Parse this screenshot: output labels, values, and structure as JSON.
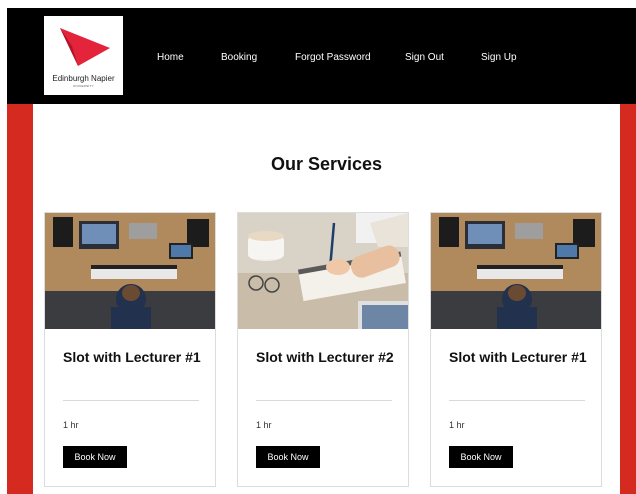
{
  "nav": {
    "logo_text": "Edinburgh Napier",
    "logo_sub": "UNIVERSITY",
    "items": [
      {
        "label": "Home"
      },
      {
        "label": "Booking"
      },
      {
        "label": "Forgot Password"
      },
      {
        "label": "Sign Out"
      },
      {
        "label": "Sign Up"
      }
    ]
  },
  "main": {
    "heading": "Our Services",
    "cards": [
      {
        "title": "Slot with Lecturer #1",
        "duration": "1 hr",
        "button_label": "Book Now",
        "image": "music-studio-desk-photo"
      },
      {
        "title": "Slot with Lecturer #2",
        "duration": "1 hr",
        "button_label": "Book Now",
        "image": "writing-notebook-coffee-photo"
      },
      {
        "title": "Slot with Lecturer #1",
        "duration": "1 hr",
        "button_label": "Book Now",
        "image": "music-studio-desk-photo"
      }
    ]
  },
  "colors": {
    "accent": "#d42a20",
    "nav_bg": "#000000",
    "logo_red": "#e3243b"
  }
}
